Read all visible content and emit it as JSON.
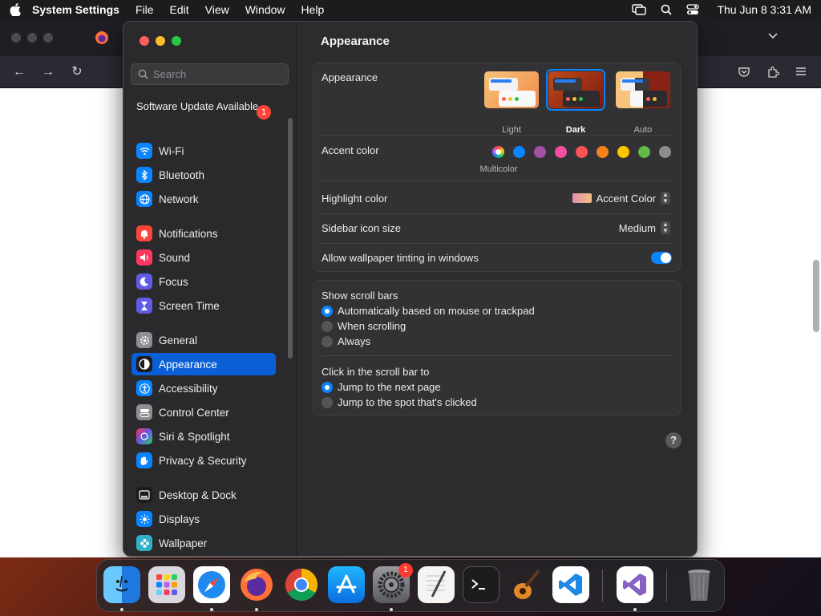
{
  "menubar": {
    "app_name": "System Settings",
    "items": [
      "File",
      "Edit",
      "View",
      "Window",
      "Help"
    ],
    "clock": "Thu Jun 8  3:31 AM"
  },
  "window": {
    "title": "Appearance"
  },
  "search": {
    "placeholder": "Search"
  },
  "sidebar": {
    "update": {
      "label": "Software Update Available",
      "badge": "1"
    },
    "items": [
      {
        "label": "Wi-Fi",
        "icon": "wifi-icon",
        "color": "#0a84ff"
      },
      {
        "label": "Bluetooth",
        "icon": "bluetooth-icon",
        "color": "#0a84ff"
      },
      {
        "label": "Network",
        "icon": "globe-icon",
        "color": "#0a84ff"
      },
      {
        "label": "Notifications",
        "icon": "bell-icon",
        "color": "#ff453a"
      },
      {
        "label": "Sound",
        "icon": "speaker-icon",
        "color": "#ff375f"
      },
      {
        "label": "Focus",
        "icon": "moon-icon",
        "color": "#5e5ce6"
      },
      {
        "label": "Screen Time",
        "icon": "hourglass-icon",
        "color": "#5e5ce6"
      },
      {
        "label": "General",
        "icon": "gear-icon",
        "color": "#8e8e93"
      },
      {
        "label": "Appearance",
        "icon": "appearance-icon",
        "color": "#1c1c1e"
      },
      {
        "label": "Accessibility",
        "icon": "accessibility-icon",
        "color": "#0a84ff"
      },
      {
        "label": "Control Center",
        "icon": "control-center-icon",
        "color": "#8e8e93"
      },
      {
        "label": "Siri & Spotlight",
        "icon": "siri-icon",
        "color": "#bf5af2"
      },
      {
        "label": "Privacy & Security",
        "icon": "hand-icon",
        "color": "#0a84ff"
      },
      {
        "label": "Desktop & Dock",
        "icon": "dock-icon",
        "color": "#1c1c1e"
      },
      {
        "label": "Displays",
        "icon": "sun-icon",
        "color": "#0a84ff"
      },
      {
        "label": "Wallpaper",
        "icon": "flower-icon",
        "color": "#30b0c7"
      }
    ],
    "active": "Appearance"
  },
  "appearance": {
    "label": "Appearance",
    "options": [
      "Light",
      "Dark",
      "Auto"
    ],
    "selected": "Dark"
  },
  "accent": {
    "label": "Accent color",
    "multicolor_label": "Multicolor",
    "colors": [
      "#bf5af2",
      "#0a84ff",
      "#a550a7",
      "#f74f9e",
      "#ff5257",
      "#f7821b",
      "#ffc600",
      "#62ba46",
      "#8c8c8c"
    ]
  },
  "highlight": {
    "label": "Highlight color",
    "value": "Accent Color"
  },
  "sidebar_icon_size": {
    "label": "Sidebar icon size",
    "value": "Medium"
  },
  "wallpaper_tinting": {
    "label": "Allow wallpaper tinting in windows",
    "enabled": true
  },
  "scroll_bars": {
    "label": "Show scroll bars",
    "options": [
      "Automatically based on mouse or trackpad",
      "When scrolling",
      "Always"
    ],
    "selected": 0
  },
  "click_scroll": {
    "label": "Click in the scroll bar to",
    "options": [
      "Jump to the next page",
      "Jump to the spot that's clicked"
    ],
    "selected": 0
  },
  "help": {
    "label": "?"
  },
  "dock": {
    "apps": [
      "Finder",
      "Launchpad",
      "Safari",
      "Firefox",
      "Chrome",
      "App Store",
      "System Settings",
      "TextEdit",
      "Terminal",
      "GarageBand",
      "Visual Studio Code",
      "Visual Studio",
      "Trash"
    ],
    "settings_badge": "1"
  }
}
